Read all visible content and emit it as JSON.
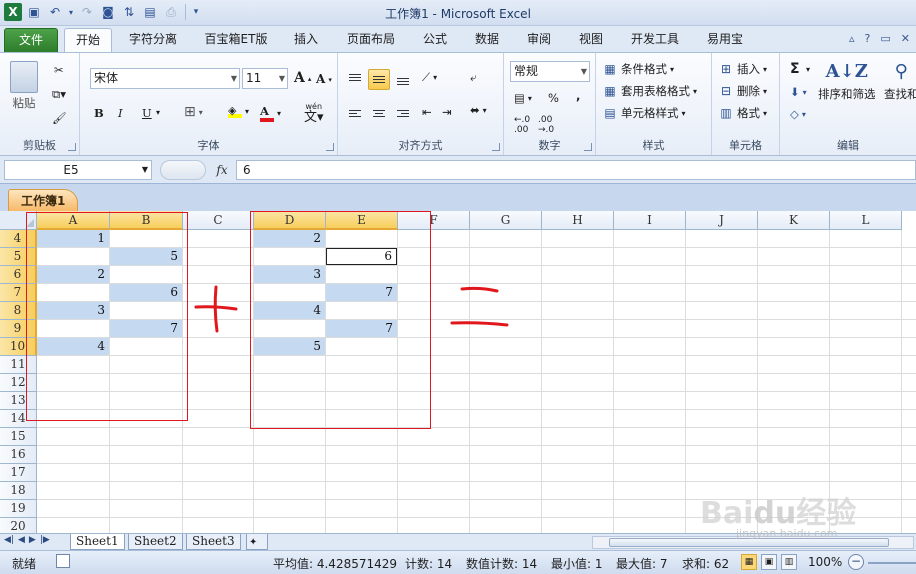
{
  "window": {
    "title": "工作簿1 - Microsoft Excel"
  },
  "ribbon_tabs": [
    "文件",
    "开始",
    "字符分离",
    "百宝箱ET版",
    "插入",
    "页面布局",
    "公式",
    "数据",
    "审阅",
    "视图",
    "开发工具",
    "易用宝"
  ],
  "ribbon": {
    "clipboard": {
      "paste": "粘贴",
      "label": "剪贴板"
    },
    "font": {
      "name": "宋体",
      "size": "11",
      "label": "字体",
      "bold": "B",
      "italic": "I",
      "underline": "U",
      "phonetic": "wén"
    },
    "alignment": {
      "label": "对齐方式"
    },
    "number": {
      "format": "常规",
      "label": "数字",
      "percent": "%",
      "comma": ","
    },
    "styles": {
      "conditional": "条件格式",
      "table": "套用表格格式",
      "cell_styles": "单元格样式",
      "label": "样式"
    },
    "cells": {
      "insert": "插入",
      "delete": "删除",
      "format": "格式",
      "label": "单元格"
    },
    "editing": {
      "sum": "Σ",
      "sort_filter": "排序和筛选",
      "find_select": "查找和",
      "label": "编辑"
    }
  },
  "formula_bar": {
    "name_box": "E5",
    "fx": "fx",
    "value": "6"
  },
  "workbook_tab": "工作簿1",
  "columns": [
    "A",
    "B",
    "C",
    "D",
    "E",
    "F",
    "G",
    "H",
    "I",
    "J",
    "K",
    "L"
  ],
  "rows": [
    "4",
    "5",
    "6",
    "7",
    "8",
    "9",
    "10",
    "11",
    "12",
    "13",
    "14",
    "15",
    "16",
    "17",
    "18",
    "19",
    "20"
  ],
  "selected": {
    "column": "E",
    "row": "5"
  },
  "cells": {
    "A4": "1",
    "B5": "5",
    "A6": "2",
    "B7": "6",
    "A8": "3",
    "B9": "7",
    "A10": "4",
    "D4": "2",
    "E5": "6",
    "D6": "3",
    "E7": "7",
    "D8": "4",
    "E9": "7",
    "D10": "5"
  },
  "sheets": [
    "Sheet1",
    "Sheet2",
    "Sheet3"
  ],
  "status": {
    "mode": "就绪",
    "average": "平均值: 4.428571429",
    "count": "计数: 14",
    "numeric_count": "数值计数: 14",
    "min": "最小值: 1",
    "max": "最大值: 7",
    "sum": "求和: 62",
    "zoom": "100%"
  },
  "watermark": {
    "text": "Baidu经验",
    "url": "jingyan.baidu.com"
  },
  "colors": {
    "highlight": "#c5d9f1",
    "annotation_red": "#e0181e",
    "file_tab": "#2d7d2b"
  }
}
